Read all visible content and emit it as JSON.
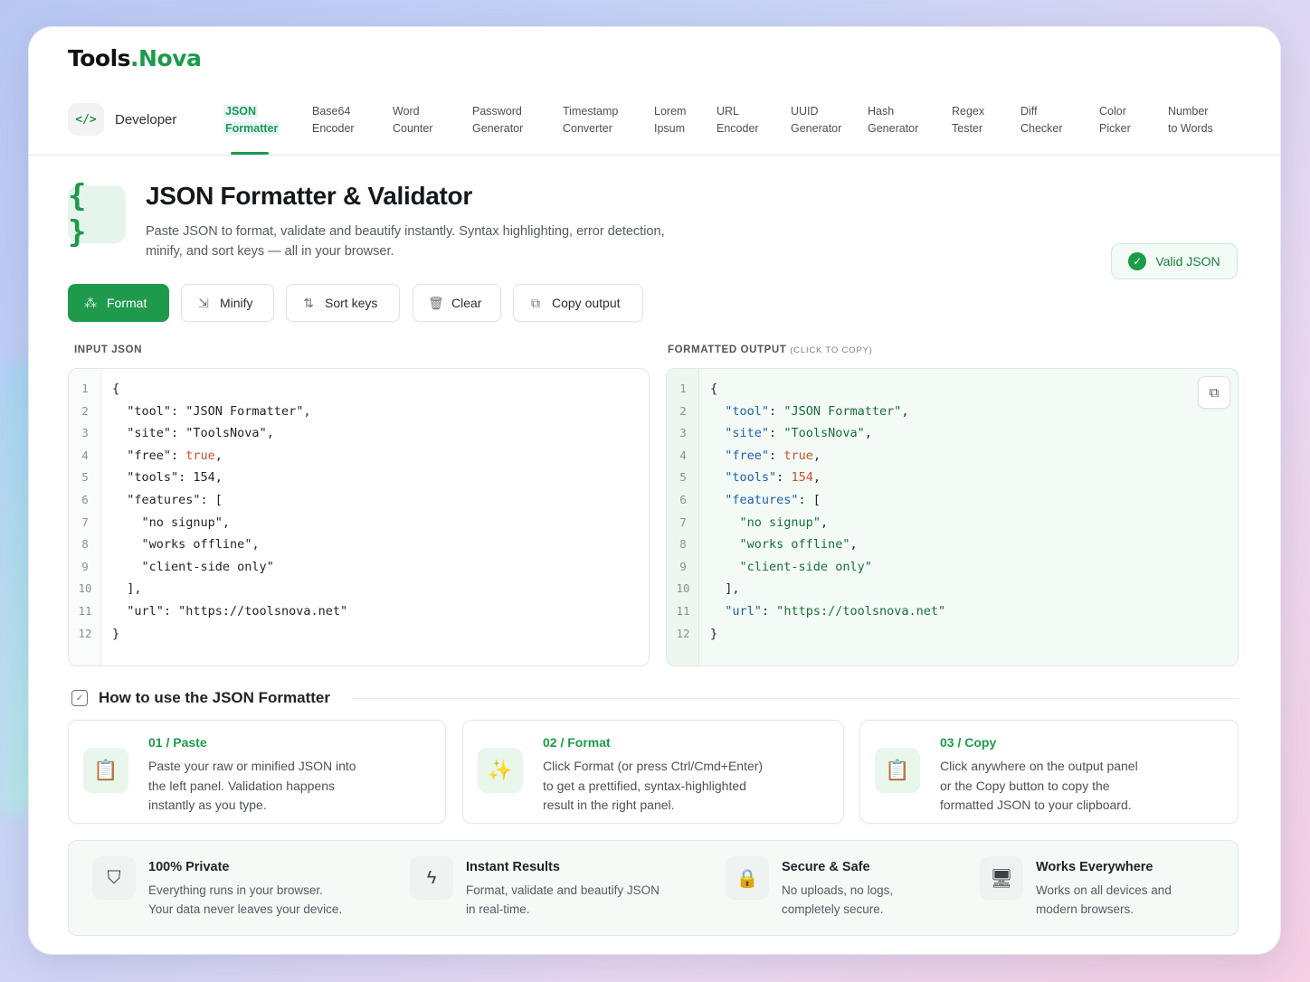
{
  "brand": {
    "name_main": "Tools",
    "name_dot": ".",
    "name_accent": "Nova"
  },
  "nav": {
    "category": {
      "icon": "code-icon",
      "glyph": "</>",
      "label": "Developer"
    },
    "tabs": [
      {
        "line1": "JSON",
        "line2": "Formatter",
        "active": true
      },
      {
        "line1": "Base64",
        "line2": "Encoder"
      },
      {
        "line1": "Word",
        "line2": "Counter"
      },
      {
        "line1": "Password",
        "line2": "Generator"
      },
      {
        "line1": "Timestamp",
        "line2": "Converter"
      },
      {
        "line1": "Lorem",
        "line2": "Ipsum"
      },
      {
        "line1": "URL",
        "line2": "Encoder"
      },
      {
        "line1": "UUID",
        "line2": "Generator"
      },
      {
        "line1": "Hash",
        "line2": "Generator"
      },
      {
        "line1": "Regex",
        "line2": "Tester"
      },
      {
        "line1": "Diff",
        "line2": "Checker"
      },
      {
        "line1": "Color",
        "line2": "Picker"
      },
      {
        "line1": "Number",
        "line2": "to Words"
      }
    ]
  },
  "header": {
    "icon_glyph": "{ }",
    "title": "JSON Formatter & Validator",
    "description_line1": "Paste JSON to format, validate and beautify instantly. Syntax highlighting, error detection,",
    "description_line2": "minify, and sort keys — all in your browser.",
    "status": "Valid JSON"
  },
  "toolbar": {
    "format": "Format",
    "minify": "Minify",
    "sort_keys": "Sort keys",
    "clear": "Clear",
    "copy_output": "Copy output"
  },
  "panels": {
    "input_label": "INPUT JSON",
    "output_label": "FORMATTED OUTPUT",
    "output_sublabel": "(CLICK TO COPY)",
    "line_numbers": [
      "1",
      "2",
      "3",
      "4",
      "5",
      "6",
      "7",
      "8",
      "9",
      "10",
      "11",
      "12"
    ]
  },
  "json_content": {
    "tool": "JSON Formatter",
    "site": "ToolsNova",
    "free": "true",
    "tools": "154",
    "features": [
      "no signup",
      "works offline",
      "client-side only"
    ],
    "url": "https://toolsnova.net"
  },
  "howto": {
    "title": "How to use the JSON Formatter",
    "steps": [
      {
        "num": "01 / Paste",
        "l1": "Paste your raw or minified JSON into",
        "l2": "the left panel. Validation happens",
        "l3": "instantly as you type."
      },
      {
        "num": "02 / Format",
        "l1": "Click Format (or press Ctrl/Cmd+Enter)",
        "l2": "to get a prettified, syntax-highlighted",
        "l3": "result in the right panel."
      },
      {
        "num": "03 / Copy",
        "l1": "Click anywhere on the output panel",
        "l2": "or the Copy button to copy the",
        "l3": "formatted JSON to your clipboard."
      }
    ]
  },
  "features": [
    {
      "title": "100% Private",
      "l1": "Everything runs in your browser.",
      "l2": "Your data never leaves your device."
    },
    {
      "title": "Instant Results",
      "l1": "Format, validate and beautify JSON",
      "l2": "in real-time."
    },
    {
      "title": "Secure & Safe",
      "l1": "No uploads, no logs,",
      "l2": "completely secure."
    },
    {
      "title": "Works Everywhere",
      "l1": "Works on all devices and",
      "l2": "modern browsers."
    }
  ],
  "colors": {
    "accent": "#1c9b4a",
    "key": "#1d5fae",
    "literal": "#c7522a"
  }
}
